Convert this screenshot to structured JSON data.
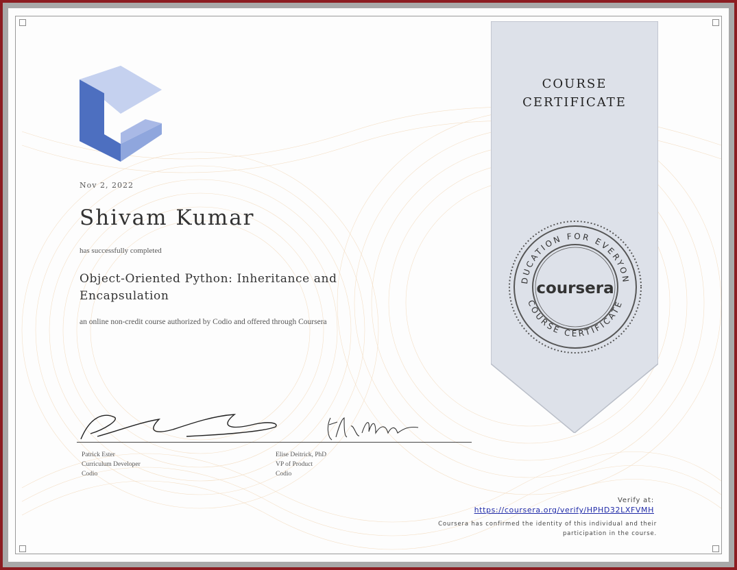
{
  "certificate": {
    "ribbon_title_line1": "COURSE",
    "ribbon_title_line2": "CERTIFICATE",
    "date": "Nov 2, 2022",
    "recipient_name": "Shivam Kumar",
    "completed_text": "has successfully completed",
    "course_title": "Object-Oriented Python: Inheritance and Encapsulation",
    "offered_text": "an online non-credit course authorized by Codio and offered through Coursera"
  },
  "signers": [
    {
      "name": "Patrick Ester",
      "role": "Curriculum Developer",
      "org": "Codio"
    },
    {
      "name": "Elise Deitrick, PhD",
      "role": "VP of Product",
      "org": "Codio"
    }
  ],
  "seal": {
    "top_text": "EDUCATION FOR EVERYONE",
    "center_text": "coursera",
    "bottom_text": "COURSE CERTIFICATE"
  },
  "verify": {
    "label": "Verify at:",
    "url": "https://coursera.org/verify/HPHD32LXFVMH",
    "note_line1": "Coursera has confirmed the identity of this individual and their",
    "note_line2": "participation in the course."
  },
  "colors": {
    "border_outer": "#8c1d22",
    "ribbon": "#dde1e9",
    "logo_dark": "#4d6fc0",
    "logo_mid": "#8fa6dd",
    "logo_light": "#c5d1ef",
    "link": "#1f2aa8"
  },
  "icons": [
    "codio-logo",
    "coursera-seal"
  ]
}
